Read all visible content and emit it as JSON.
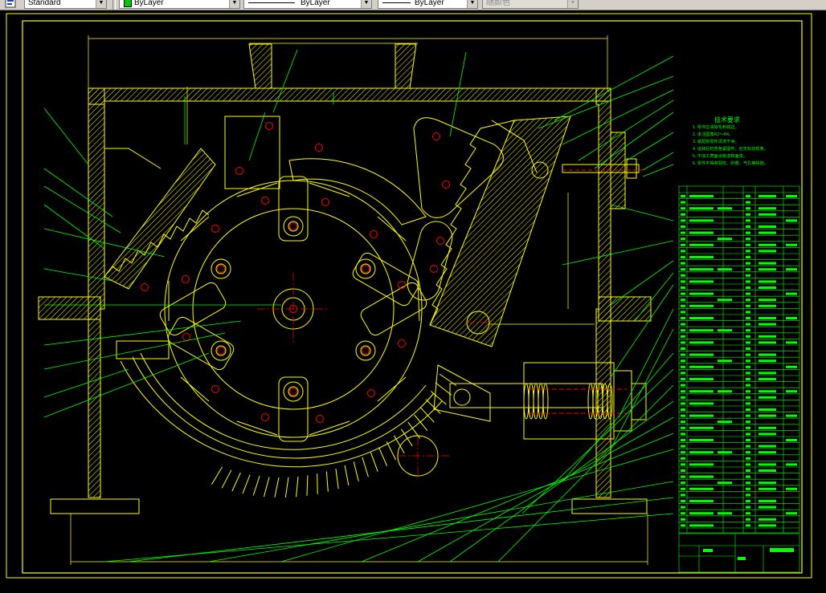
{
  "toolbar": {
    "text_style": "Standard",
    "color": "ByLayer",
    "color_swatch": "#00c800",
    "linetype": "ByLayer",
    "lineweight": "ByLayer",
    "plot_style": "随颜色"
  },
  "drawing": {
    "tech_title": "技术要求",
    "tech_notes": [
      "1. 零件应清除毛刺锐边。",
      "2. 未注圆角R2～R4。",
      "3. 装配前零件清洗干净。",
      "4. 运转后检查各紧固件，应无松动现象。",
      "5. 不加工表面涂底漆和面漆。",
      "6. 零件不得有裂纹、砂眼、气孔等缺陷。"
    ],
    "colors": {
      "background": "#000000",
      "frame": "#ffff00",
      "part": "#ffff00",
      "leader": "#00ff00",
      "hole": "#ff0000",
      "section": "#ffff00"
    }
  }
}
